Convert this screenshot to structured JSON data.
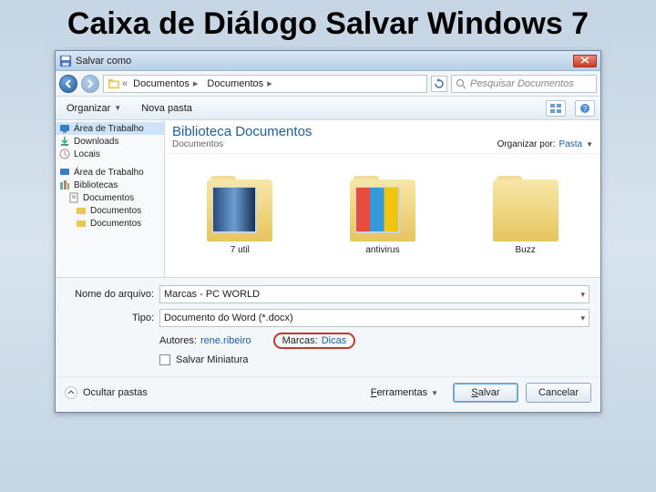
{
  "slide_title": "Caixa de Diálogo Salvar Windows 7",
  "titlebar": {
    "text": "Salvar como"
  },
  "nav": {
    "crumbs": [
      "Documentos",
      "Documentos"
    ],
    "search_placeholder": "Pesquisar Documentos"
  },
  "toolbar": {
    "organize": "Organizar",
    "new_folder": "Nova pasta"
  },
  "sidebar": {
    "group1": [
      {
        "icon": "desktop",
        "label": "Área de Trabalho"
      },
      {
        "icon": "download",
        "label": "Downloads"
      },
      {
        "icon": "recent",
        "label": "Locais"
      }
    ],
    "group2": [
      {
        "icon": "desktop",
        "label": "Área de Trabalho"
      },
      {
        "icon": "library",
        "label": "Bibliotecas"
      },
      {
        "icon": "doc",
        "label": "Documentos",
        "indent": 1
      },
      {
        "icon": "folder",
        "label": "Documentos",
        "indent": 2
      },
      {
        "icon": "folder",
        "label": "Documentos",
        "indent": 2
      }
    ]
  },
  "library": {
    "title": "Biblioteca Documentos",
    "subtitle": "Documentos",
    "organize_by_label": "Organizar por:",
    "organize_by_value": "Pasta"
  },
  "folders": [
    {
      "name": "7 util",
      "variant": "util"
    },
    {
      "name": "antivirus",
      "variant": "av"
    },
    {
      "name": "Buzz",
      "variant": "plain"
    }
  ],
  "form": {
    "filename_label": "Nome do arquivo:",
    "filename_value": "Marcas - PC WORLD",
    "type_label": "Tipo:",
    "type_value": "Documento do Word (*.docx)",
    "authors_label": "Autores:",
    "authors_value": "rene.ribeiro",
    "tags_label": "Marcas:",
    "tags_value": "Dicas",
    "save_thumb": "Salvar Miniatura"
  },
  "actions": {
    "hide_folders": "Ocultar pastas",
    "tools": "Ferramentas",
    "save": "Salvar",
    "cancel": "Cancelar"
  }
}
